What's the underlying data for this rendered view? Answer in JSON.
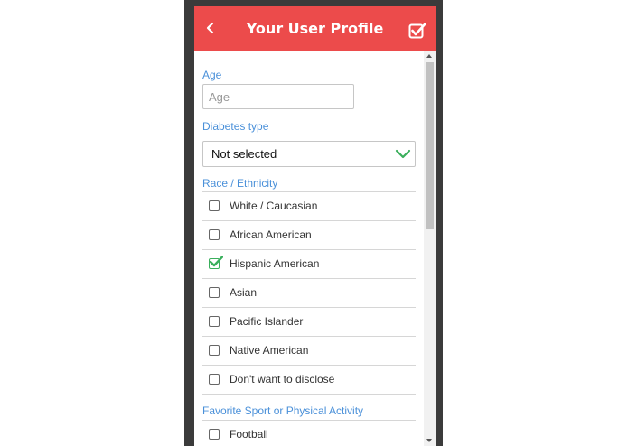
{
  "header": {
    "title": "Your User Profile",
    "back_icon": "chevron-left-icon",
    "save_icon": "checkbox-check-icon"
  },
  "age": {
    "label": "Age",
    "placeholder": "Age",
    "value": ""
  },
  "diabetes": {
    "label": "Diabetes type",
    "selected": "Not selected",
    "icon": "chevron-down-icon"
  },
  "race": {
    "label": "Race / Ethnicity",
    "options": [
      {
        "label": "White / Caucasian",
        "checked": false
      },
      {
        "label": "African American",
        "checked": false
      },
      {
        "label": "Hispanic American",
        "checked": true
      },
      {
        "label": "Asian",
        "checked": false
      },
      {
        "label": "Pacific Islander",
        "checked": false
      },
      {
        "label": "Native American",
        "checked": false
      },
      {
        "label": "Don't want to disclose",
        "checked": false
      }
    ]
  },
  "sport": {
    "label": "Favorite Sport or Physical Activity",
    "options": [
      {
        "label": "Football",
        "checked": false
      }
    ]
  },
  "colors": {
    "header_bg": "#ec4b4b",
    "label_blue": "#4a90d9",
    "check_green": "#3aaf5c",
    "frame": "#3b3b3b"
  }
}
